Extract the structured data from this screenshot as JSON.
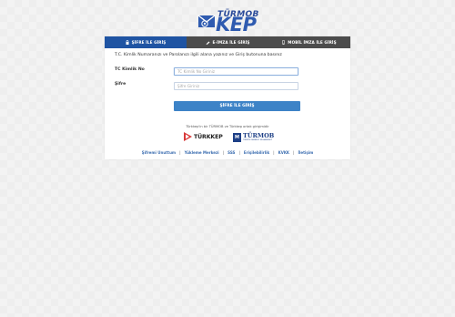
{
  "logo": {
    "top_text": "TÜRMOB",
    "main_text": "KEP"
  },
  "tabs": [
    {
      "label": "ŞİFRE İLE GİRİŞ",
      "icon": "lock-icon",
      "active": true
    },
    {
      "label": "E-İMZA İLE GİRİŞ",
      "icon": "pen-icon",
      "active": false
    },
    {
      "label": "MOBİL İMZA İLE GİRİŞ",
      "icon": "mobile-icon",
      "active": false
    }
  ],
  "form": {
    "instruction": "T.C. Kimlik Numaranızı ve Parolanızı ilgili alana yazınız ve Giriş butonuna basınız",
    "tc_label": "TC Kimlik No",
    "tc_placeholder": "TC Kimlik No Giriniz",
    "password_label": "Şifre",
    "password_placeholder": "Şifre Giriniz",
    "submit_label": "ŞİFRE İLE GİRİŞ"
  },
  "partners": {
    "note": "Türkkep'in bir TÜRMOB ve Türkkep ortak girişimidir",
    "logo1": "TÜRKKEP",
    "logo2_main": "TÜRMOB",
    "logo2_sub": "TÜRKİYE SERBEST MUHASEBECİ"
  },
  "footer_links": [
    "Şifremi Unuttum",
    "Yükleme Merkezi",
    "SSS",
    "Erişilebilirlik",
    "KVKK",
    "İletişim"
  ],
  "colors": {
    "accent": "#1f54a3",
    "tab_inactive": "#4c4c4c",
    "button": "#3d83c7",
    "link": "#3b6db0"
  }
}
